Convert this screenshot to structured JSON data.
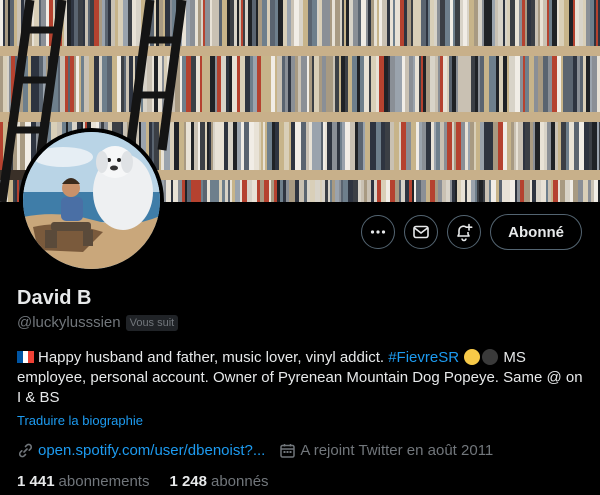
{
  "profile": {
    "name": "David B",
    "handle": "@luckylusssien",
    "follows_you_badge": "Vous suit"
  },
  "actions": {
    "more_icon": "more-horizontal-icon",
    "message_icon": "envelope-icon",
    "notify_icon": "bell-plus-icon",
    "follow_label": "Abonné"
  },
  "bio": {
    "flag": "france-flag",
    "text_1": "Happy husband and father, music lover, vinyl addict. ",
    "hashtag": "#FievreSR",
    "text_2": " MS employee, personal account. Owner of Pyrenean Mountain Dog Popeye. Same @ on I & BS",
    "translate_label": "Traduire la biographie"
  },
  "meta": {
    "link": "open.spotify.com/user/dbenoist?...",
    "joined": "A rejoint Twitter en août 2011"
  },
  "stats": {
    "following_count": "1 441",
    "following_label": "abonnements",
    "followers_count": "1 248",
    "followers_label": "abonnés"
  },
  "colors": {
    "background": "#000000",
    "accent": "#1d9bf0",
    "text": "#e7e9ea",
    "muted": "#71767b",
    "border": "#536471",
    "yellow_dot": "#f7c948",
    "dark_dot": "#3a3a3a"
  }
}
